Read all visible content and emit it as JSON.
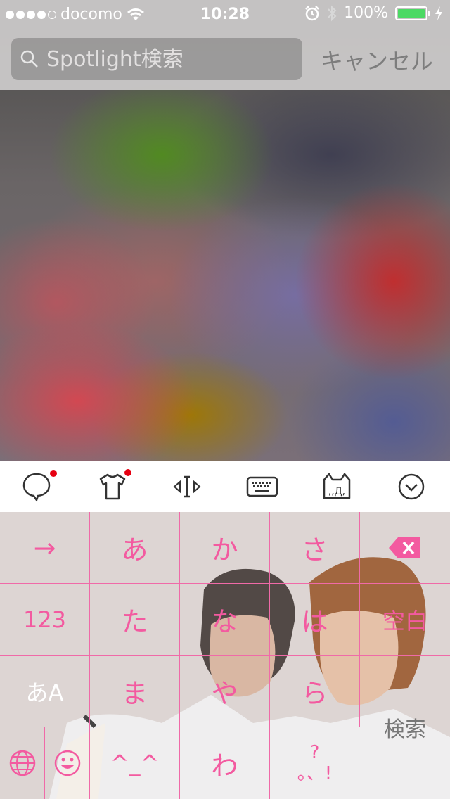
{
  "status": {
    "carrier": "docomo",
    "time": "10:28",
    "battery": "100%",
    "battery_level": 1.0
  },
  "search": {
    "placeholder": "Spotlight検索",
    "value": "",
    "cancel_label": "キャンセル"
  },
  "toolbar": {
    "items": [
      "chat-bubble-icon",
      "shirt-icon",
      "cursor-move-icon",
      "keyboard-icon",
      "cat-face-icon",
      "chevron-down-icon"
    ]
  },
  "keyboard": {
    "rows": [
      [
        "→",
        "あ",
        "か",
        "さ",
        "⌫"
      ],
      [
        "123",
        "た",
        "な",
        "は",
        "空白"
      ],
      [
        "あA",
        "ま",
        "や",
        "ら",
        "検索"
      ],
      [
        "🌐",
        "☺",
        "^_^",
        "わ",
        "?。、!"
      ]
    ],
    "emoticon": "^_^",
    "punct_top": "?",
    "punct_bottom": "。、!",
    "colors": {
      "key_text": "#f35aa0",
      "grid": "#f06aa8"
    }
  }
}
